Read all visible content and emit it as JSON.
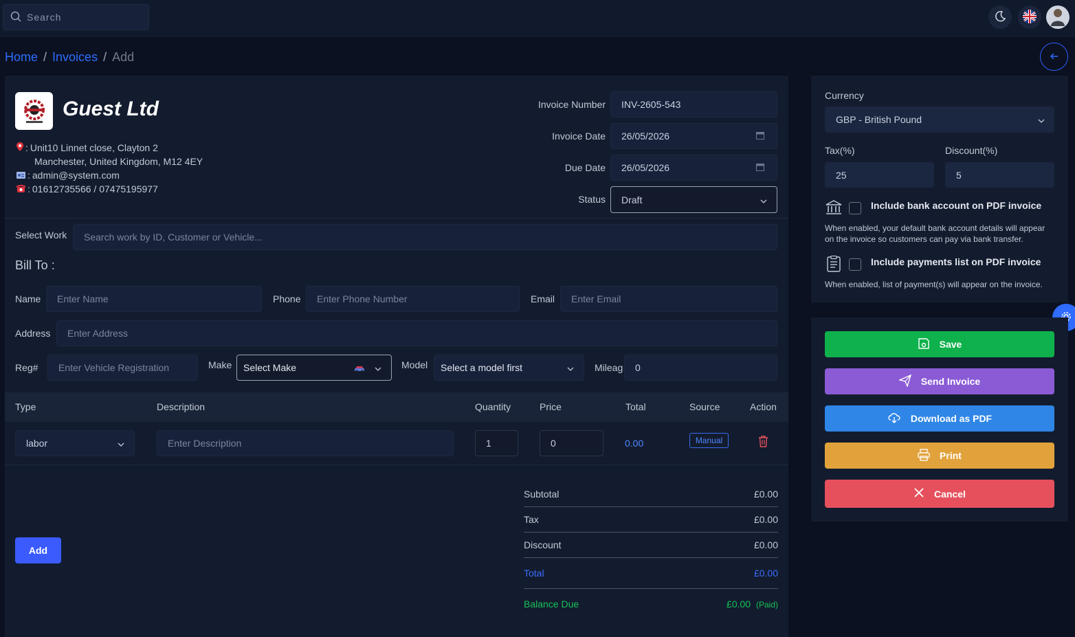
{
  "search": {
    "placeholder": "Search"
  },
  "breadcrumb": {
    "home": "Home",
    "invoices": "Invoices",
    "current": "Add",
    "separator": "/"
  },
  "company": {
    "name": "Guest Ltd",
    "address_line1": "Unit10 Linnet close, Clayton 2",
    "address_line2": "Manchester, United Kingdom, M12 4EY",
    "email": "admin@system.com",
    "phones": "01612735566 / 07475195977",
    "sep": ":"
  },
  "invoice": {
    "number_label": "Invoice Number",
    "number_value": "INV-2605-543",
    "date_label": "Invoice Date",
    "date_value": "26/05/2026",
    "due_label": "Due Date",
    "due_value": "26/05/2026",
    "status_label": "Status",
    "status_value": "Draft"
  },
  "select_work": {
    "label": "Select Work",
    "placeholder": "Search work by ID, Customer or Vehicle..."
  },
  "bill_to": {
    "title": "Bill To :",
    "name_label": "Name",
    "name_placeholder": "Enter Name",
    "phone_label": "Phone",
    "phone_placeholder": "Enter Phone Number",
    "email_label": "Email",
    "email_placeholder": "Enter Email",
    "address_label": "Address",
    "address_placeholder": "Enter Address",
    "reg_label": "Reg#",
    "reg_placeholder": "Enter Vehicle Registration",
    "make_label": "Make",
    "make_value": "Select Make",
    "model_label": "Model",
    "model_value": "Select a model first",
    "mileage_label": "Mileag",
    "mileage_value": "0"
  },
  "table": {
    "headers": [
      "Type",
      "Description",
      "Quantity",
      "Price",
      "Total",
      "Source",
      "Action"
    ],
    "rows": [
      {
        "type": "labor",
        "description_placeholder": "Enter Description",
        "quantity": "1",
        "price": "0",
        "total": "0.00",
        "source": "Manual"
      }
    ]
  },
  "totals": {
    "subtotal_label": "Subtotal",
    "subtotal": "£0.00",
    "tax_label": "Tax",
    "tax": "£0.00",
    "discount_label": "Discount",
    "discount": "£0.00",
    "total_label": "Total",
    "total": "£0.00",
    "balance_label": "Balance Due",
    "balance": "£0.00",
    "balance_status": "(Paid)"
  },
  "add_button": "Add",
  "settings": {
    "currency_label": "Currency",
    "currency_value": "GBP - British Pound",
    "tax_label": "Tax(%)",
    "tax_value": "25",
    "discount_label": "Discount(%)",
    "discount_value": "5",
    "bank_title": "Include bank account on PDF invoice",
    "bank_desc": "When enabled, your default bank account details will appear on the invoice so customers can pay via bank transfer.",
    "payments_title": "Include payments list on PDF invoice",
    "payments_desc": "When enabled, list of payment(s) will appear on the invoice."
  },
  "actions": {
    "save": "Save",
    "send": "Send Invoice",
    "download": "Download as PDF",
    "print": "Print",
    "cancel": "Cancel"
  },
  "colors": {
    "save": "#0fb14c",
    "send": "#8b5bd6",
    "download": "#2f86e6",
    "print": "#e2a23b",
    "cancel": "#e6505d",
    "accent": "#2f6cff"
  }
}
